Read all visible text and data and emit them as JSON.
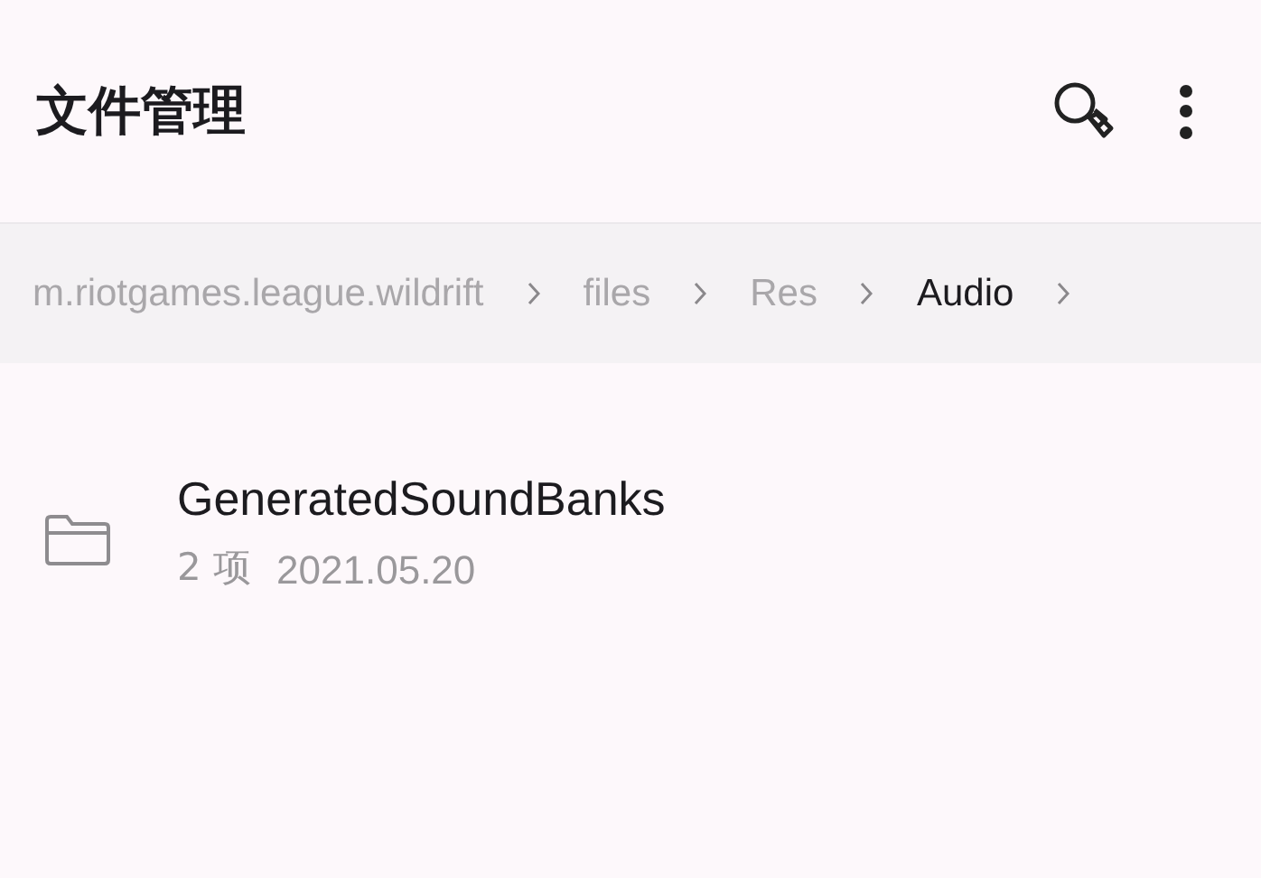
{
  "app_bar": {
    "title": "文件管理"
  },
  "breadcrumb": [
    {
      "label": "m.riotgames.league.wildrift",
      "selected": false
    },
    {
      "label": "files",
      "selected": false
    },
    {
      "label": "Res",
      "selected": false
    },
    {
      "label": "Audio",
      "selected": true
    }
  ],
  "files": [
    {
      "name": "GeneratedSoundBanks",
      "count": "2 项",
      "date": "2021.05.20"
    }
  ]
}
